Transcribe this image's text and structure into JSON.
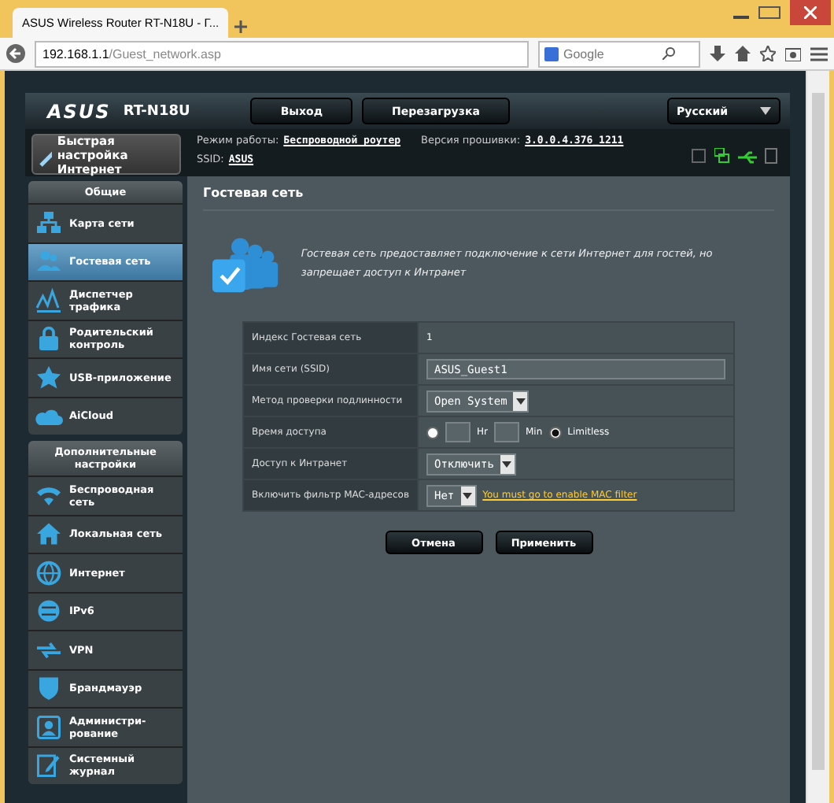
{
  "browser": {
    "tab_title": "ASUS Wireless Router RT-N18U - Г...",
    "address_host": "192.168.1.1",
    "address_path": "/Guest_network.asp",
    "search_placeholder": "Google"
  },
  "header": {
    "logo": "ASUS",
    "model": "RT-N18U",
    "buttons": [
      "Выход",
      "Перезагрузка"
    ],
    "language": "Русский"
  },
  "info": {
    "mode_label": "Режим работы:",
    "mode_value": "Беспроводной роутер",
    "firmware_label": "Версия прошивки:",
    "firmware_value": "3.0.0.4.376_1211",
    "ssid_label": "SSID:",
    "ssid_value": "ASUS"
  },
  "quick_setup": "Быстрая настройка Интернет",
  "sidebar": [
    {
      "title": "Общие",
      "items": [
        {
          "label": "Карта сети",
          "selected": false
        },
        {
          "label": "Гостевая сеть",
          "selected": true
        },
        {
          "label": "Диспетчер трафика",
          "selected": false
        },
        {
          "label": "Родительский контроль",
          "selected": false
        },
        {
          "label": "USB-приложение",
          "selected": false
        },
        {
          "label": "AiCloud",
          "selected": false
        }
      ]
    },
    {
      "title": "Дополнительные настройки",
      "items": [
        {
          "label": "Беспроводная сеть",
          "selected": false
        },
        {
          "label": "Локальная сеть",
          "selected": false
        },
        {
          "label": "Интернет",
          "selected": false
        },
        {
          "label": "IPv6",
          "selected": false
        },
        {
          "label": "VPN",
          "selected": false
        },
        {
          "label": "Брандмауэр",
          "selected": false
        },
        {
          "label": "Администри-рование",
          "selected": false
        },
        {
          "label": "Системный журнал",
          "selected": false
        }
      ]
    }
  ],
  "panel": {
    "title": "Гостевая сеть",
    "description": "Гостевая сеть предоставляет подключение к сети Интернет для гостей, но запрещает доступ к Интранет",
    "rows": [
      {
        "kind": "text",
        "label": "Индекс Гостевая сеть",
        "value": "1"
      },
      {
        "kind": "input",
        "label": "Имя сети (SSID)",
        "value": "ASUS_Guest1"
      },
      {
        "kind": "select",
        "label": "Метод проверки подлинности",
        "value": "Open System"
      },
      {
        "kind": "time",
        "label": "Время доступа",
        "limited_selected": false,
        "hr_label": "Hr",
        "min_label": "Min",
        "limitless_label": "Limitless",
        "limitless_selected": true
      },
      {
        "kind": "select",
        "label": "Доступ к Интранет",
        "value": "Отключить"
      },
      {
        "kind": "select_link",
        "label": "Включить фильтр MAC-адресов",
        "value": "Нет",
        "link": "You must go to enable MAC filter"
      }
    ]
  },
  "buttons": [
    "Отмена",
    "Применить"
  ]
}
